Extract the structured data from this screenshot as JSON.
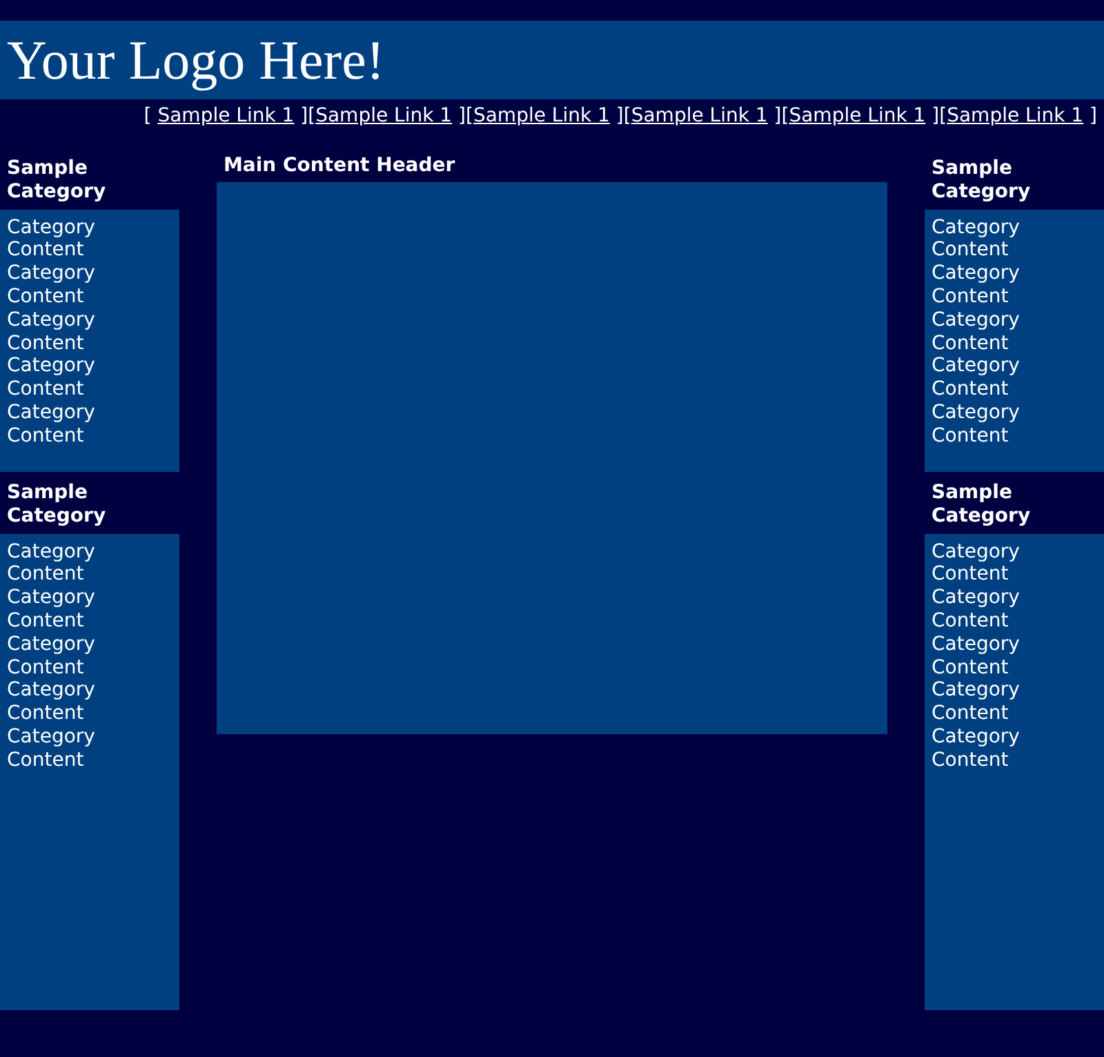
{
  "logo": "Your Logo Here!",
  "nav": {
    "open": "[",
    "separator": "][",
    "close": "]",
    "links": [
      "Sample Link 1",
      "Sample Link 1",
      "Sample Link 1",
      "Sample Link 1",
      "Sample Link 1",
      "Sample Link 1"
    ]
  },
  "left_column": [
    {
      "title": "Sample Category",
      "content": "Category Content Category Content Category Content Category Content Category Content"
    },
    {
      "title": "Sample Category",
      "content": "Category Content Category Content Category Content Category Content Category Content"
    }
  ],
  "main": {
    "header": "Main Content Header"
  },
  "right_column": [
    {
      "title": "Sample Category",
      "content": "Category Content Category Content Category Content Category Content Category Content"
    },
    {
      "title": "Sample Category",
      "content": "Category Content Category Content Category Content Category Content Category Content"
    }
  ]
}
